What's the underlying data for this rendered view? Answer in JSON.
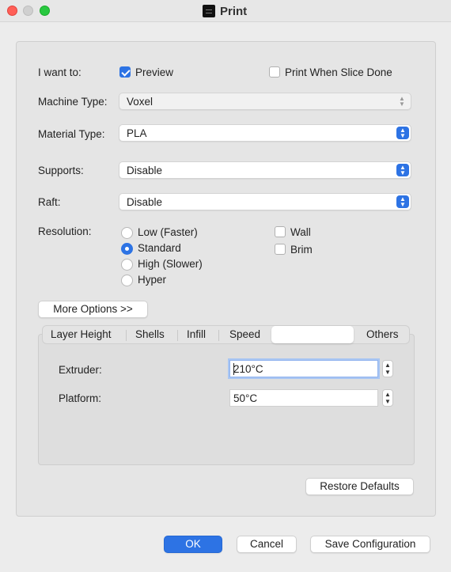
{
  "window": {
    "title": "Print"
  },
  "form": {
    "i_want_to_label": "I want to:",
    "preview_label": "Preview",
    "preview_checked": true,
    "print_when_done_label": "Print When Slice Done",
    "print_when_done_checked": false,
    "machine_type_label": "Machine Type:",
    "machine_type_value": "Voxel",
    "material_type_label": "Material Type:",
    "material_type_value": "PLA",
    "supports_label": "Supports:",
    "supports_value": "Disable",
    "raft_label": "Raft:",
    "raft_value": "Disable",
    "resolution_label": "Resolution:",
    "resolution_options": [
      "Low (Faster)",
      "Standard",
      "High (Slower)",
      "Hyper"
    ],
    "resolution_selected": "Standard",
    "wall_label": "Wall",
    "brim_label": "Brim",
    "more_options_label": "More Options >>"
  },
  "tabs": {
    "items": [
      "Layer Height",
      "Shells",
      "Infill",
      "Speed",
      "",
      "Others"
    ],
    "selected_index": 4
  },
  "temperature": {
    "extruder_label": "Extruder:",
    "extruder_value": "210°C",
    "platform_label": "Platform:",
    "platform_value": "50°C"
  },
  "buttons": {
    "restore_defaults": "Restore Defaults",
    "ok": "OK",
    "cancel": "Cancel",
    "save_configuration": "Save Configuration"
  },
  "colors": {
    "accent": "#2d73e4",
    "close": "#ff5f57",
    "maximize": "#28c840"
  }
}
